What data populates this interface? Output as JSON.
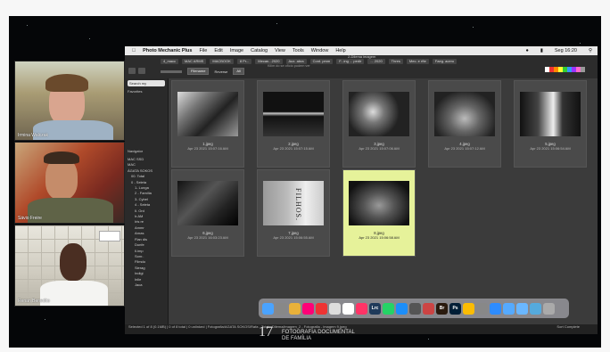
{
  "participants": [
    {
      "name": "Irmina Walczak"
    },
    {
      "name": "Sávio Freire"
    },
    {
      "name": "Renan Benedito"
    }
  ],
  "app": {
    "menu": [
      "Photo Mechanic Plus",
      "File",
      "Edit",
      "Image",
      "Catalog",
      "View",
      "Tools",
      "Window",
      "Help"
    ],
    "clock": "Seg 16:20",
    "window_title": "2-Dilema imagem",
    "path_crumbs": [
      "4_macc",
      "MAC ARMS",
      "MACBOOK",
      "8 Pr...",
      "Mecan...2020",
      "Aux. abra",
      "Cont. pmm",
      "F...ing ... pedir",
      "... 2020",
      "Thres",
      "Mec. e rfte",
      "Faeg. acero"
    ],
    "tooltip": "Kilim do se ofício podem ver",
    "sort_select": "Filename",
    "reverse_label": "Reverse",
    "filter_select": "All",
    "search_placeholder": "Search my",
    "favorites_label": "Favorites",
    "navigator_label": "Navigator",
    "tree": [
      "MAC SSD",
      "MAC",
      "ÁGATA SOKOS",
      "00. Total",
      "0 - Seleta",
      "1- Lunga",
      "2 - Família",
      "3- Cybel",
      "4 - Seleta",
      "Il. Ord",
      "Ir.AM",
      "Iris re",
      "Ammr",
      "Arnas",
      "Flan dis",
      "Dunfe",
      "Il.imp",
      "Sonr..",
      "Filmdo",
      "Sierag",
      "Indigi",
      "Inlle",
      "Jaca"
    ],
    "status": "Selected 1 of 8 (0.1MB) | 0 of 8 total | 0 unlinked | Fotografia/AGATA SOKOS/Rafa - Total - Dilema/imagem_2 - Fotografia - imagem 9.jpeg",
    "status_right": "Sort Complete"
  },
  "photos": [
    {
      "file": "1.jpeg",
      "date": "Apr 23 2021 15:07:16 AM"
    },
    {
      "file": "2.jpeg",
      "date": "Apr 23 2021 15:07:15 AM"
    },
    {
      "file": "3.jpeg",
      "date": "Apr 23 2021 15:07:06 AM"
    },
    {
      "file": "4.jpeg",
      "date": "Apr 23 2021 15:07:12 AM"
    },
    {
      "file": "5.jpeg",
      "date": "Apr 23 2021 15:06:54 AM"
    },
    {
      "file": "6.jpeg",
      "date": "Apr 23 2021 16:03:23 AM"
    },
    {
      "file": "7.jpeg",
      "date": "Apr 23 2021 15:06:55 AM"
    },
    {
      "file": "8.jpeg",
      "date": "Apr 23 2021 15:06:58 AM"
    }
  ],
  "photo6_text": "FILHOS.",
  "dock_icons": [
    "finder-icon",
    "launchpad-icon",
    "chrome-icon",
    "photos-icon",
    "calendar-icon",
    "notes-icon",
    "reminders-icon",
    "music-icon",
    "lrc-icon",
    "whatsapp-icon",
    "appstore-icon",
    "screenshot-icon",
    "preview-icon",
    "bridge-icon",
    "photoshop-icon",
    "drive-icon",
    "settings-icon",
    "zoom-icon",
    "mail-icon",
    "folder-icon",
    "downloads-icon",
    "trash-icon"
  ],
  "dock_labels": {
    "lrc": "Lrc",
    "br": "Br",
    "ps": "Ps"
  },
  "overlay": {
    "number": "17",
    "line1": "FOTOGRAFIA DOCUMENTAL",
    "line2": "DE FAMÍLIA"
  }
}
